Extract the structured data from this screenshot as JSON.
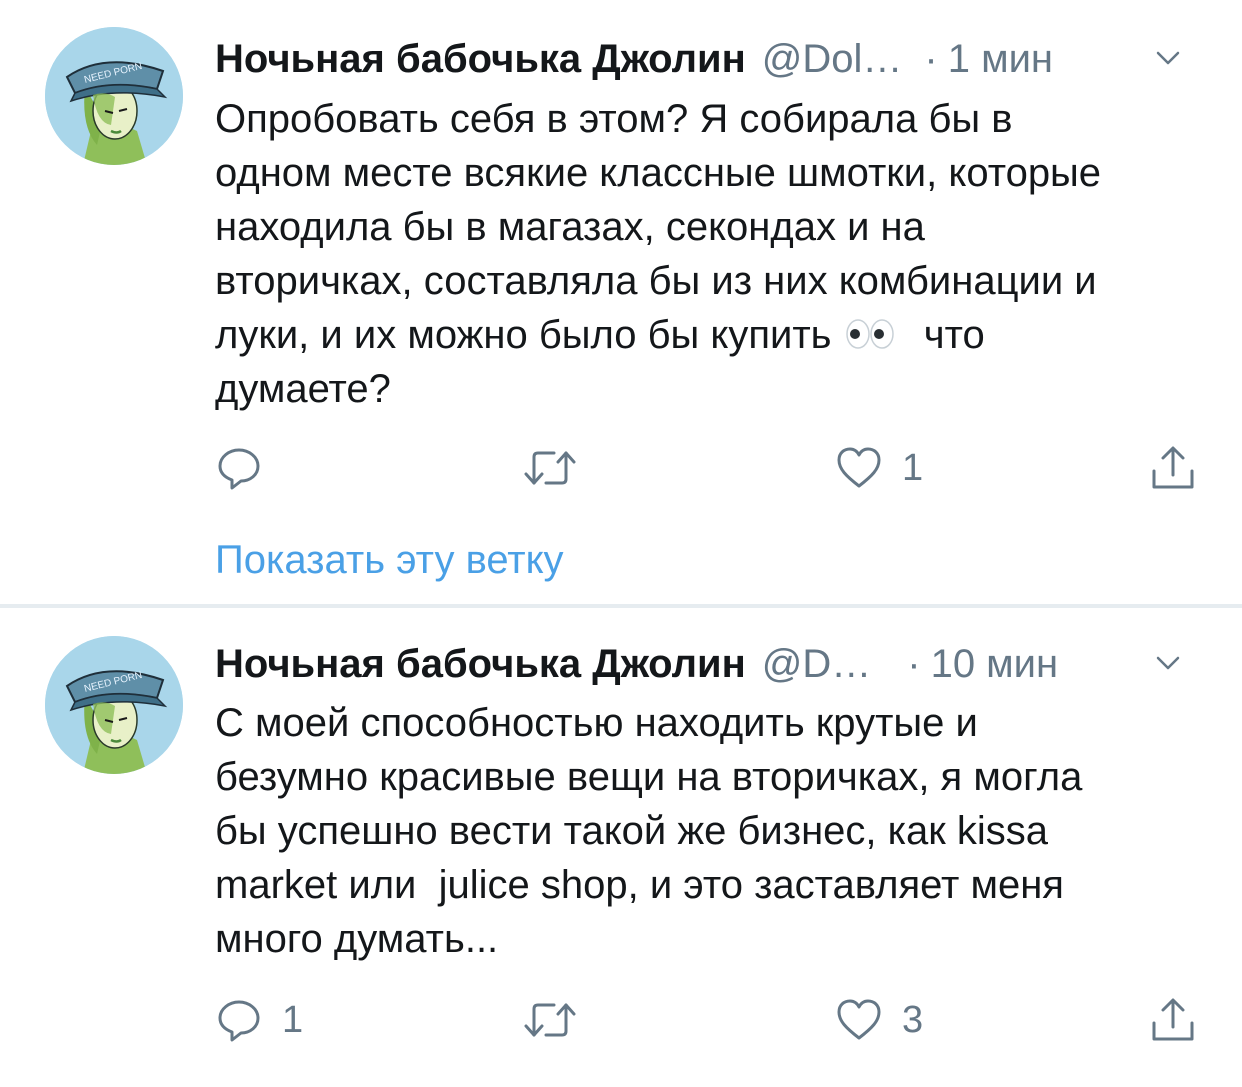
{
  "tweets": [
    {
      "author_name": "Ночьная бабочька Джолин",
      "handle": "@Dol…",
      "separator": "·",
      "time": "1 мин",
      "text_lines": [
        "Опробовать себя в этом? Я собирала бы в",
        "одном месте всякие классные шмотки, которые",
        "находила бы в магазах, секондах и на",
        "вторичках, составляла бы из них комбинации и",
        "луки, и их можно было бы купить",
        "что",
        "думаете?"
      ],
      "reply_count": "",
      "retweet_count": "",
      "like_count": "1",
      "thread_link": "Показать эту ветку",
      "avatar_cap_text": "NEED PORN"
    },
    {
      "author_name": "Ночьная бабочька Джолин",
      "handle": "@D…",
      "separator": "·",
      "time": "10 мин",
      "text_lines": [
        "С моей способностью находить крутые и",
        "безумно красивые вещи на вторичках, я могла",
        "бы успешно вести такой же бизнес, как kissa",
        "market или  julice shop, и это заставляет меня",
        "много думать..."
      ],
      "reply_count": "1",
      "retweet_count": "",
      "like_count": "3",
      "avatar_cap_text": "NEED PORN"
    }
  ],
  "icons": {
    "reply": "reply-icon",
    "retweet": "retweet-icon",
    "like": "heart-icon",
    "share": "share-icon",
    "more": "chevron-down-icon",
    "emoji": "eyes-emoji-icon"
  },
  "colors": {
    "text": "#14171a",
    "secondary": "#657786",
    "link": "#4aa0e6",
    "divider": "#e6ecf0",
    "avatar_bg": "#a9d6ea"
  }
}
